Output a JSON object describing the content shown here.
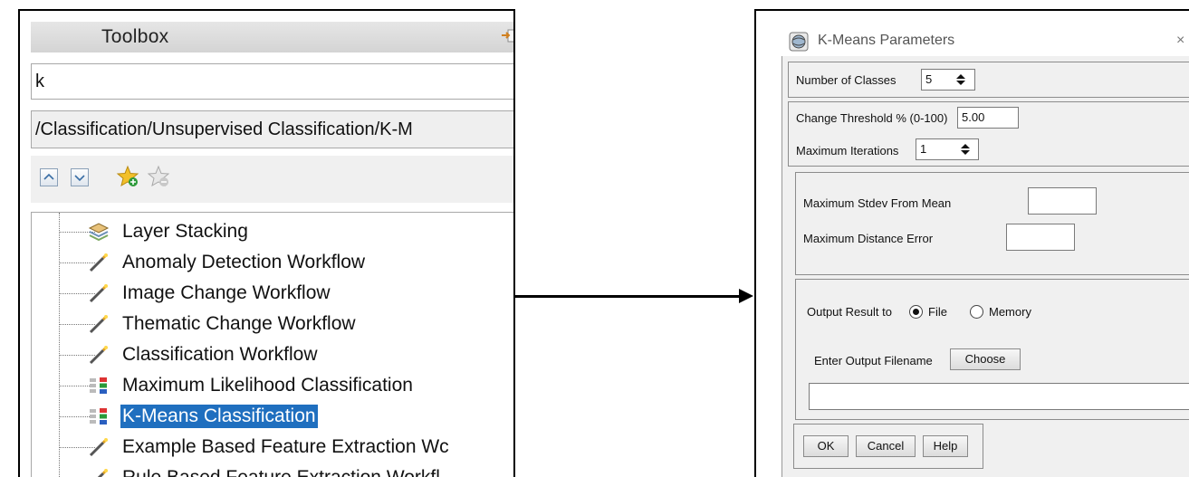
{
  "toolbox": {
    "title": "Toolbox",
    "search_value": "k",
    "path": "/Classification/Unsupervised Classification/K-M",
    "tree_items": [
      {
        "label": "Layer Stacking",
        "icon": "layer-stack-icon",
        "selected": false
      },
      {
        "label": "Anomaly Detection Workflow",
        "icon": "wand-icon",
        "selected": false
      },
      {
        "label": "Image Change Workflow",
        "icon": "wand-icon",
        "selected": false
      },
      {
        "label": "Thematic Change Workflow",
        "icon": "wand-icon",
        "selected": false
      },
      {
        "label": "Classification Workflow",
        "icon": "wand-icon",
        "selected": false
      },
      {
        "label": "Maximum Likelihood Classification",
        "icon": "classification-tool-icon",
        "selected": false
      },
      {
        "label": "K-Means Classification",
        "icon": "classification-tool-icon",
        "selected": true
      },
      {
        "label": "Example Based Feature Extraction Wc",
        "icon": "wand-icon",
        "selected": false
      },
      {
        "label": "Rule Based Feature Extraction Workfl",
        "icon": "wand-icon",
        "selected": false
      }
    ],
    "selection_color": "#1f6fbf"
  },
  "dialog": {
    "title": "K-Means Parameters",
    "close_glyph": "×",
    "number_of_classes_label": "Number of Classes",
    "number_of_classes_value": "5",
    "change_threshold_label": "Change Threshold % (0-100)",
    "change_threshold_value": "5.00",
    "max_iterations_label": "Maximum Iterations",
    "max_iterations_value": "1",
    "max_stdev_label": "Maximum Stdev From Mean",
    "max_stdev_value": "",
    "max_distance_label": "Maximum Distance Error",
    "max_distance_value": "",
    "output_result_label": "Output Result to",
    "output_options": [
      {
        "label": "File",
        "selected": true
      },
      {
        "label": "Memory",
        "selected": false
      }
    ],
    "output_filename_label": "Enter Output Filename",
    "choose_button": "Choose",
    "output_filename_value": "",
    "ok_button": "OK",
    "cancel_button": "Cancel",
    "help_button": "Help"
  }
}
